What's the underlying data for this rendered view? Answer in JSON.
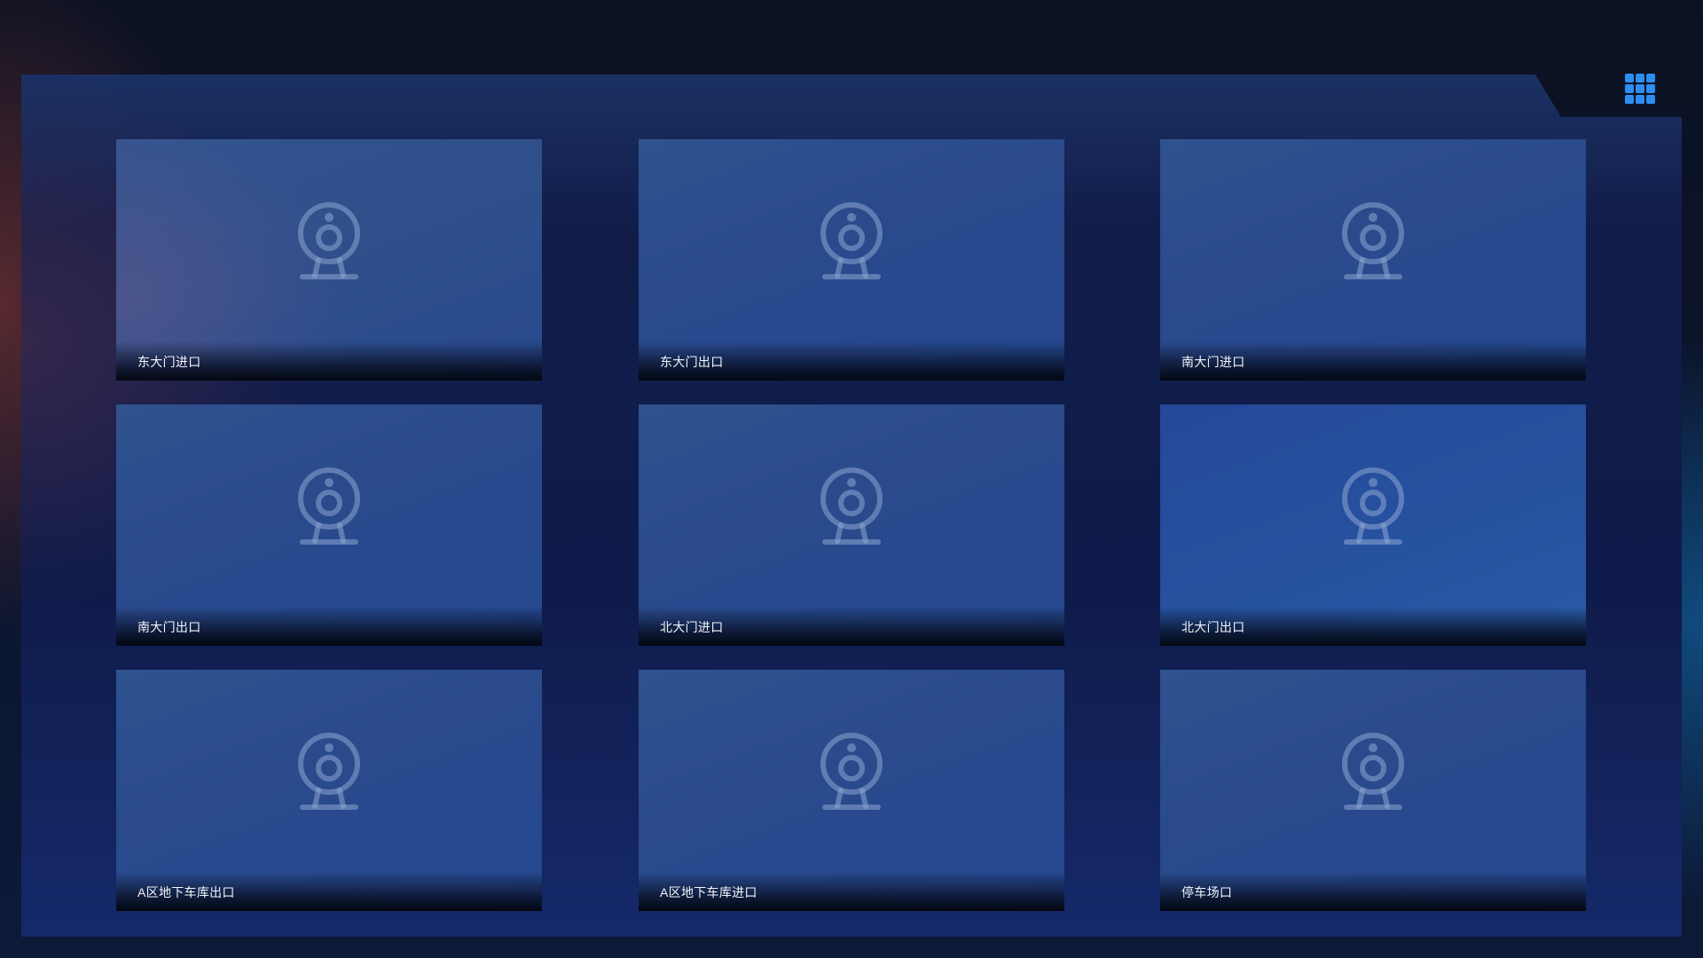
{
  "toolbar": {
    "layout_icon": "grid-3x3-icon",
    "accent_color": "#2e8ef0"
  },
  "cameras": [
    {
      "label": "东大门进口",
      "icon": "webcam-icon"
    },
    {
      "label": "东大门出口",
      "icon": "webcam-icon"
    },
    {
      "label": "南大门进口",
      "icon": "webcam-icon"
    },
    {
      "label": "南大门出口",
      "icon": "webcam-icon"
    },
    {
      "label": "北大门进口",
      "icon": "webcam-icon"
    },
    {
      "label": "北大门出口",
      "icon": "webcam-icon"
    },
    {
      "label": "A区地下车库出口",
      "icon": "webcam-icon"
    },
    {
      "label": "A区地下车库进口",
      "icon": "webcam-icon"
    },
    {
      "label": "停车场口",
      "icon": "webcam-icon"
    }
  ]
}
